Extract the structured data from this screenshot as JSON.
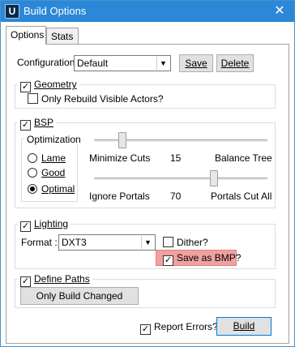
{
  "window": {
    "title": "Build Options"
  },
  "tabs": [
    {
      "label": "Options"
    },
    {
      "label": "Stats"
    }
  ],
  "configuration": {
    "label": "Configuration:",
    "value": "Default",
    "save_label": "Save",
    "delete_label": "Delete"
  },
  "geometry": {
    "title": "Geometry",
    "checked": true,
    "only_rebuild_label": "Only Rebuild Visible Actors?",
    "only_rebuild_checked": false
  },
  "bsp": {
    "title": "BSP",
    "checked": true,
    "optimization_title": "Optimization",
    "radios": [
      {
        "label": "Lame",
        "selected": false
      },
      {
        "label": "Good",
        "selected": false
      },
      {
        "label": "Optimal",
        "selected": true
      }
    ],
    "slider1": {
      "left_label": "Minimize Cuts",
      "value": "15",
      "right_label": "Balance Tree",
      "position": 0.18
    },
    "slider2": {
      "left_label": "Ignore Portals",
      "value": "70",
      "right_label": "Portals Cut All",
      "position": 0.7
    }
  },
  "lighting": {
    "title": "Lighting",
    "checked": true,
    "format_label": "Format :",
    "format_value": "DXT3",
    "dither_label": "Dither?",
    "dither_checked": false,
    "save_bmp_label": "Save as BMP?",
    "save_bmp_checked": true
  },
  "paths": {
    "title": "Define Paths",
    "checked": true,
    "only_build_changed_label": "Only Build Changed"
  },
  "footer": {
    "report_errors_label": "Report Errors?",
    "report_errors_checked": true,
    "build_label": "Build"
  },
  "colors": {
    "titlebar": "#2b88d8",
    "highlight": "#f0a0a0"
  }
}
